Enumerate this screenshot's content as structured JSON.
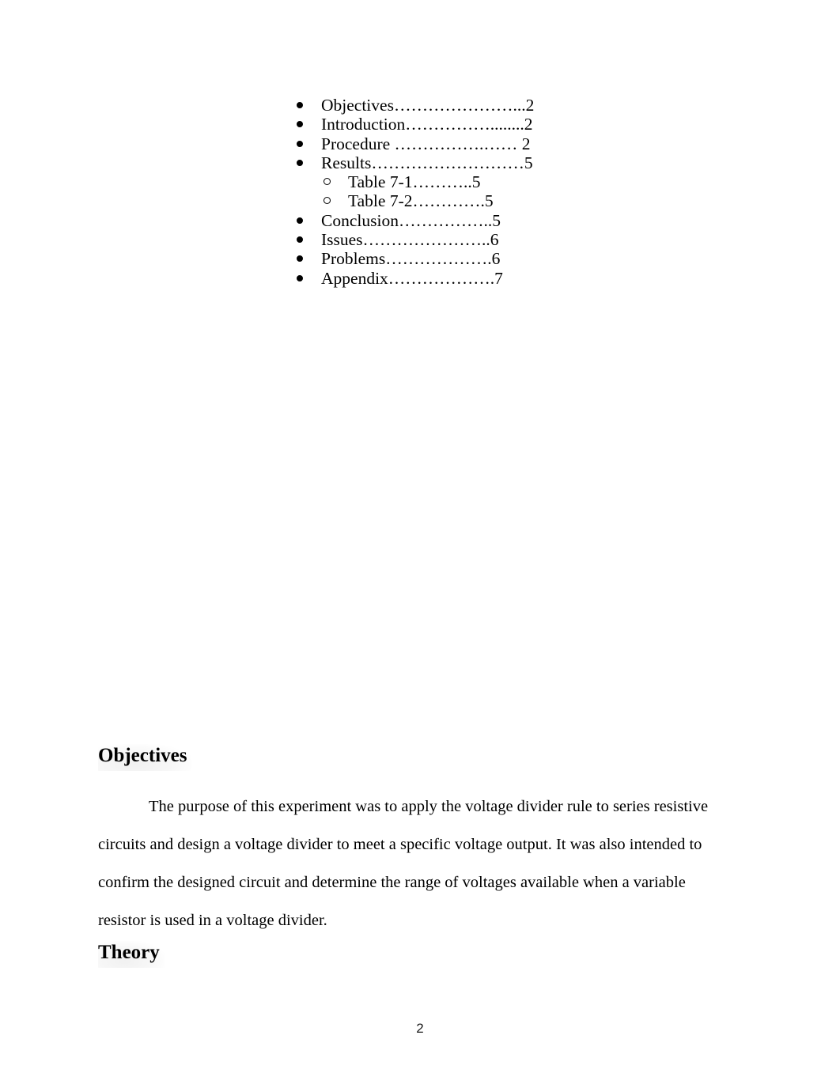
{
  "document": {
    "page_number": "2"
  },
  "toc": {
    "items": [
      {
        "level": 1,
        "bullet": "filled-disc-bullet-icon",
        "text": "Objectives…………………...2"
      },
      {
        "level": 1,
        "bullet": "filled-disc-bullet-icon",
        "text": "Introduction……………........2"
      },
      {
        "level": 1,
        "bullet": "filled-disc-bullet-icon",
        "text": "Procedure …………….…… 2"
      },
      {
        "level": 1,
        "bullet": "filled-disc-bullet-icon",
        "text": "Results………………………5"
      },
      {
        "level": 2,
        "bullet": "hollow-circle-bullet-icon",
        "text": "Table 7-1………..5"
      },
      {
        "level": 2,
        "bullet": "hollow-circle-bullet-icon",
        "text": "Table 7-2………….5"
      },
      {
        "level": 1,
        "bullet": "filled-disc-bullet-icon",
        "text": "Conclusion……………..5"
      },
      {
        "level": 1,
        "bullet": "filled-disc-bullet-icon",
        "text": "Issues…………………..6"
      },
      {
        "level": 1,
        "bullet": "filled-disc-bullet-icon",
        "text": "Problems……………….6"
      },
      {
        "level": 1,
        "bullet": "filled-disc-bullet-icon",
        "text": "Appendix……………….7"
      }
    ]
  },
  "sections": {
    "objectives": {
      "heading": "Objectives",
      "body": "The purpose of this experiment was to apply the voltage divider rule to series resistive circuits and design a voltage divider to meet a specific voltage output. It was also intended to confirm the designed circuit and determine the range of voltages available when a variable resistor is used in a voltage divider."
    },
    "theory": {
      "heading": "Theory"
    }
  }
}
